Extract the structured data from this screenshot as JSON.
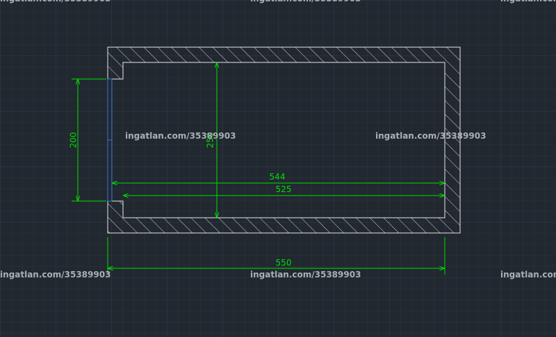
{
  "colors": {
    "background": "#212830",
    "grid_minor": "#2b333c",
    "grid_major": "#333c46",
    "wall_outline": "#e8e8e8",
    "hatch": "#d8d8d8",
    "dimension": "#00e000",
    "door": "#3a6fd8",
    "watermark": "#a9b0b6"
  },
  "watermark": {
    "text": "ingatlan.com/35389903"
  },
  "dimensions": {
    "door_opening": "200",
    "room_height": "250",
    "inner_width_upper": "544",
    "inner_width_lower": "525",
    "overall_width": "550"
  },
  "icons": {
    "door": "door-opening-icon",
    "hatch": "wall-hatch-pattern"
  }
}
